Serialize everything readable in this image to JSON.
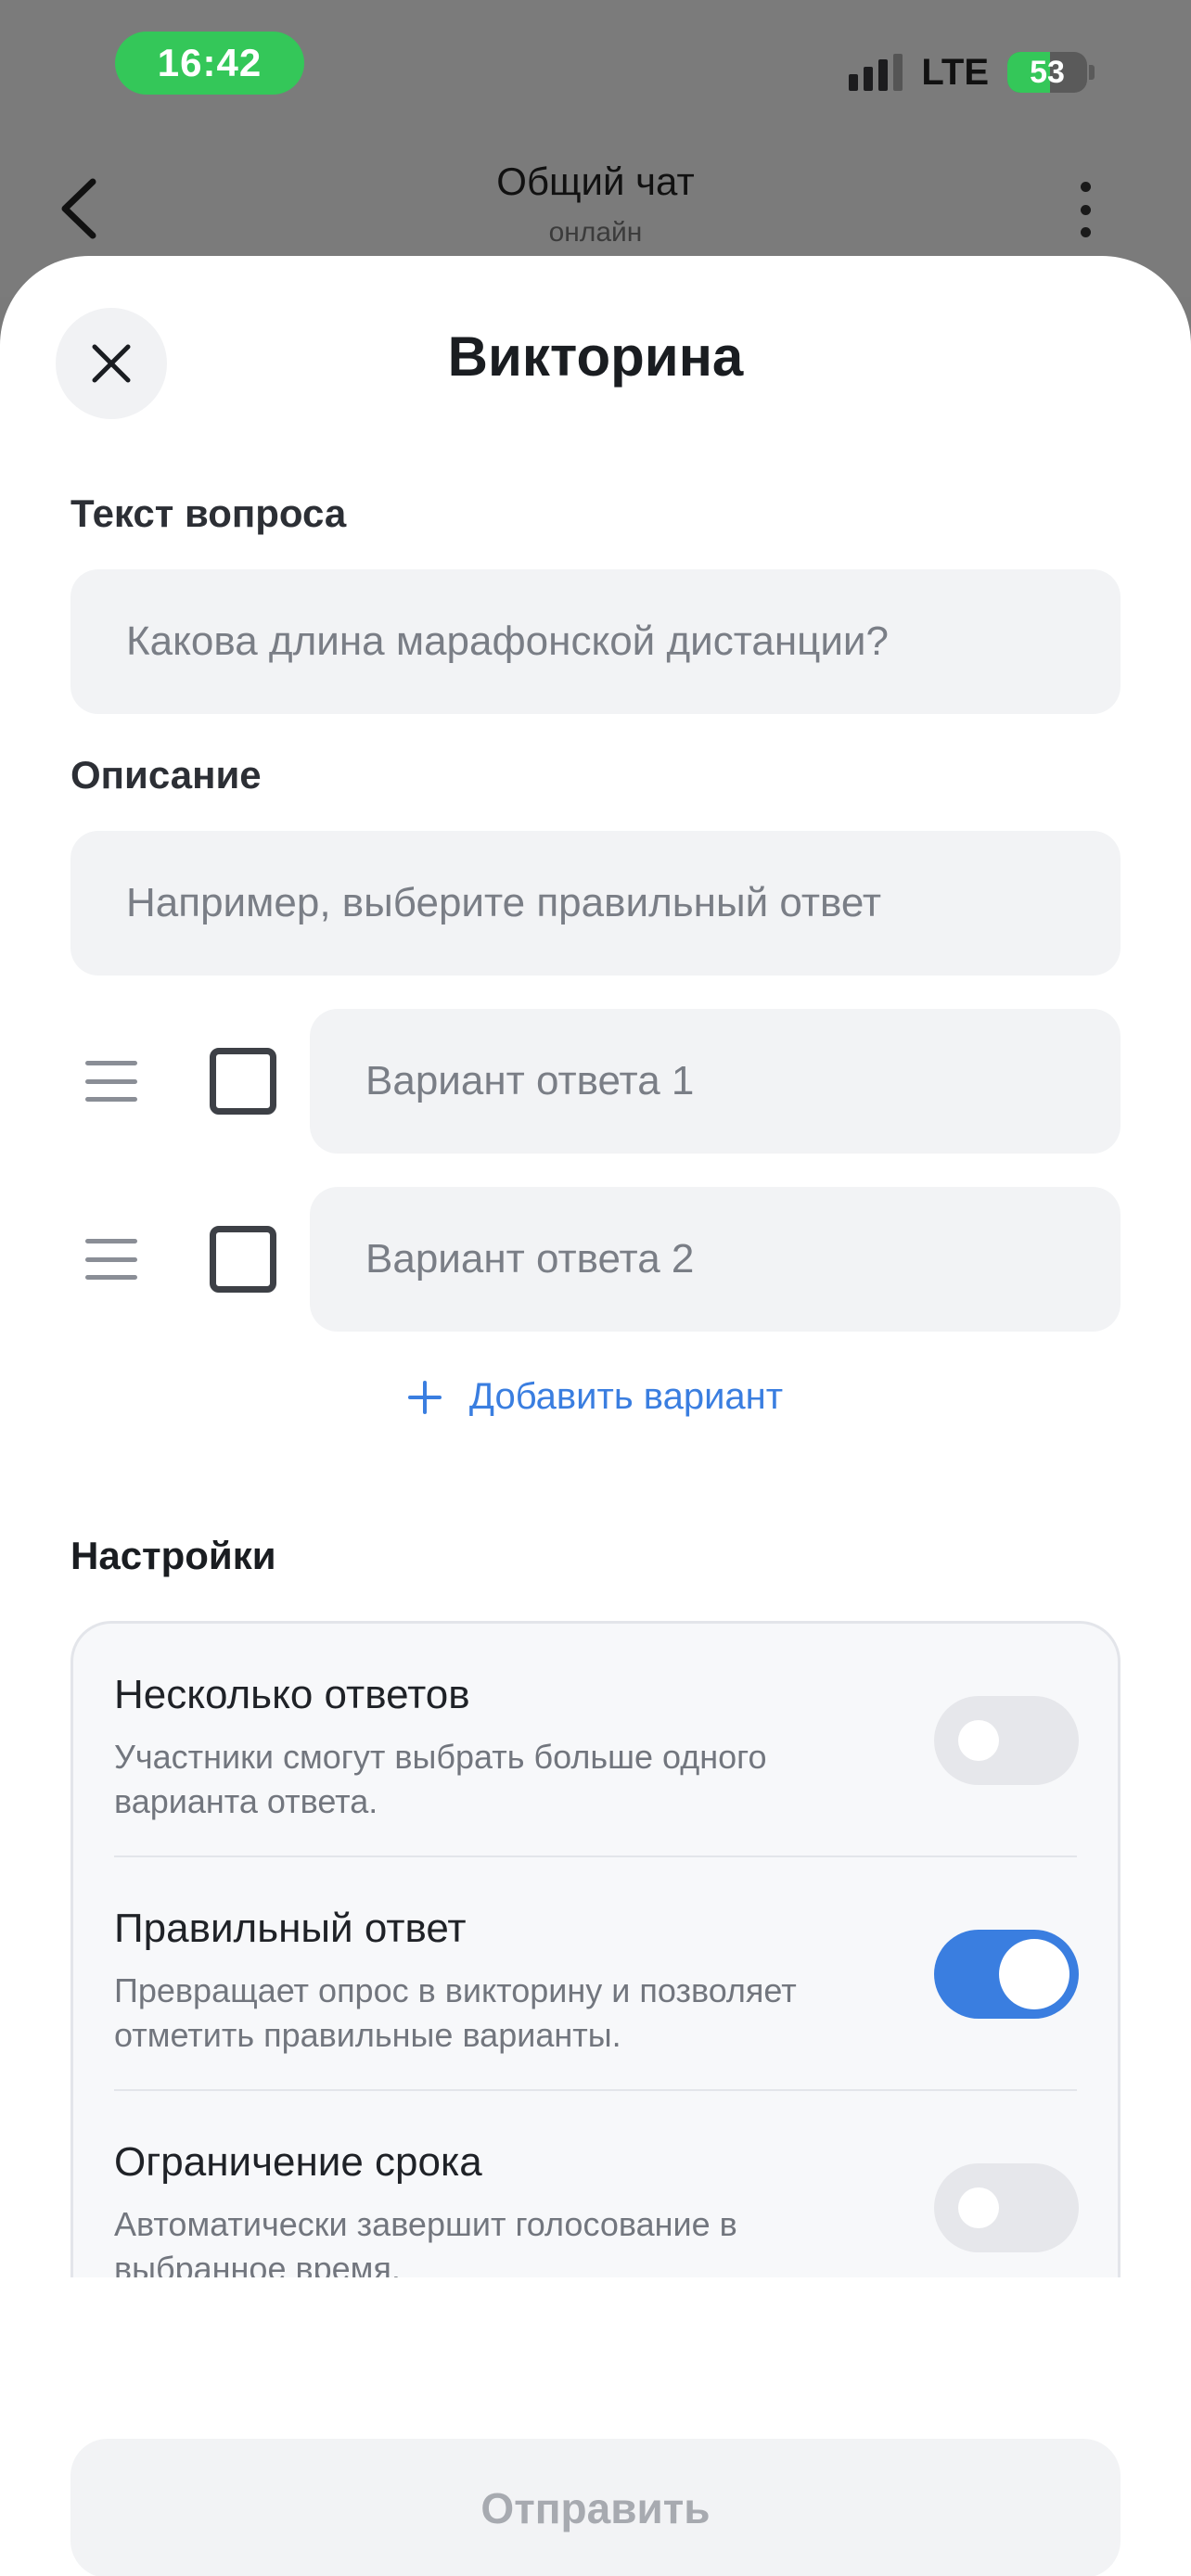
{
  "status_bar": {
    "time": "16:42",
    "network": "LTE",
    "battery_percent": "53",
    "battery_level": 0.53
  },
  "chat_header": {
    "title": "Общий чат",
    "subtitle": "онлайн",
    "back_icon": "chevron-left-icon",
    "more_icon": "more-vertical-icon"
  },
  "sheet": {
    "title": "Викторина",
    "close_icon": "close-icon",
    "question": {
      "label": "Текст вопроса",
      "placeholder": "Какова длина марафонской дистанции?",
      "value": ""
    },
    "description": {
      "label": "Описание",
      "placeholder": "Например, выберите правильный ответ",
      "value": ""
    },
    "options": [
      {
        "placeholder": "Вариант ответа 1",
        "value": "",
        "checked": false
      },
      {
        "placeholder": "Вариант ответа 2",
        "value": "",
        "checked": false
      }
    ],
    "add_option_label": "Добавить вариант",
    "settings": {
      "label": "Настройки",
      "items": [
        {
          "title": "Несколько ответов",
          "description": "Участники смогут выбрать больше одного варианта ответа.",
          "enabled": false
        },
        {
          "title": "Правильный ответ",
          "description": "Превращает опрос в викторину и позволяет отметить правильные варианты.",
          "enabled": true
        },
        {
          "title": "Ограничение срока",
          "description": "Автоматически завершит голосование в выбранное время.",
          "enabled": false
        }
      ]
    },
    "submit_label": "Отправить"
  },
  "colors": {
    "accent": "#3a7ee0",
    "status_green": "#34c759",
    "field_bg": "#f2f3f5",
    "dim_overlay": "#7b7b7b"
  }
}
